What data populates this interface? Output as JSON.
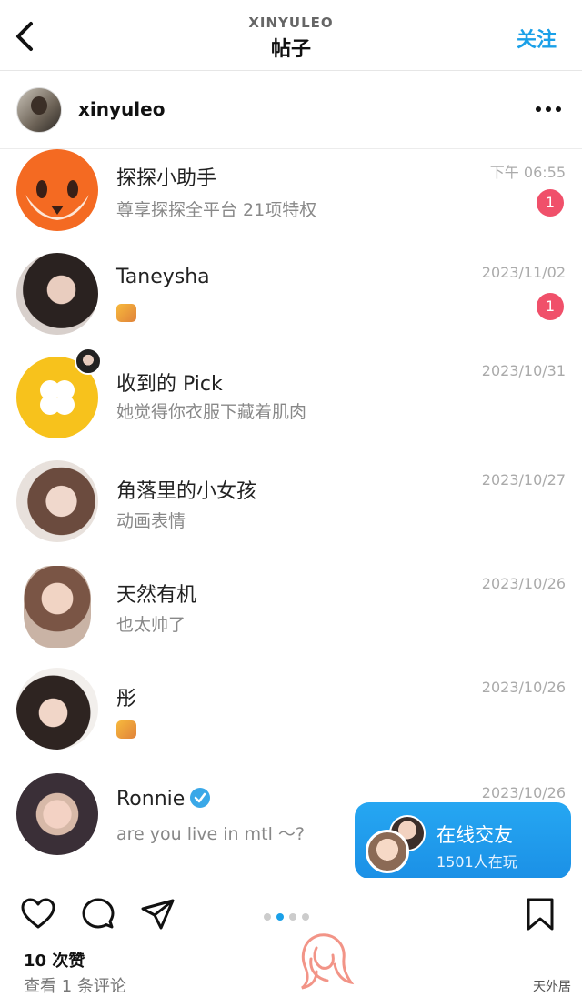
{
  "header": {
    "username": "XINYULEO",
    "title": "帖子",
    "follow_label": "关注"
  },
  "author": {
    "name": "xinyuleo"
  },
  "chats": [
    {
      "name": "探探小助手",
      "message": "尊享探探全平台 21项特权",
      "date": "下午 06:55",
      "badge": "1"
    },
    {
      "name": "Taneysha",
      "message": "",
      "date": "2023/11/02",
      "badge": "1"
    },
    {
      "name": "收到的 Pick",
      "message": "她觉得你衣服下藏着肌肉",
      "date": "2023/10/31"
    },
    {
      "name": "角落里的小女孩",
      "message": "动画表情",
      "date": "2023/10/27"
    },
    {
      "name": "天然有机",
      "message": "也太帅了",
      "date": "2023/10/26"
    },
    {
      "name": "彤",
      "message": "",
      "date": "2023/10/26"
    },
    {
      "name": "Ronnie",
      "message": "are you live in mtl ～?",
      "date": "2023/10/26"
    }
  ],
  "online_banner": {
    "title": "在线交友",
    "subtitle": "1501人在玩"
  },
  "post": {
    "likes": "10 次赞",
    "comments": "查看 1 条评论",
    "carousel_pages": 4,
    "carousel_active": 2
  },
  "watermark": "天外居",
  "colors": {
    "accent": "#1aa0e8",
    "badge": "#f0506a",
    "tantan_orange": "#f46a22",
    "pick_yellow": "#f7c21c"
  }
}
